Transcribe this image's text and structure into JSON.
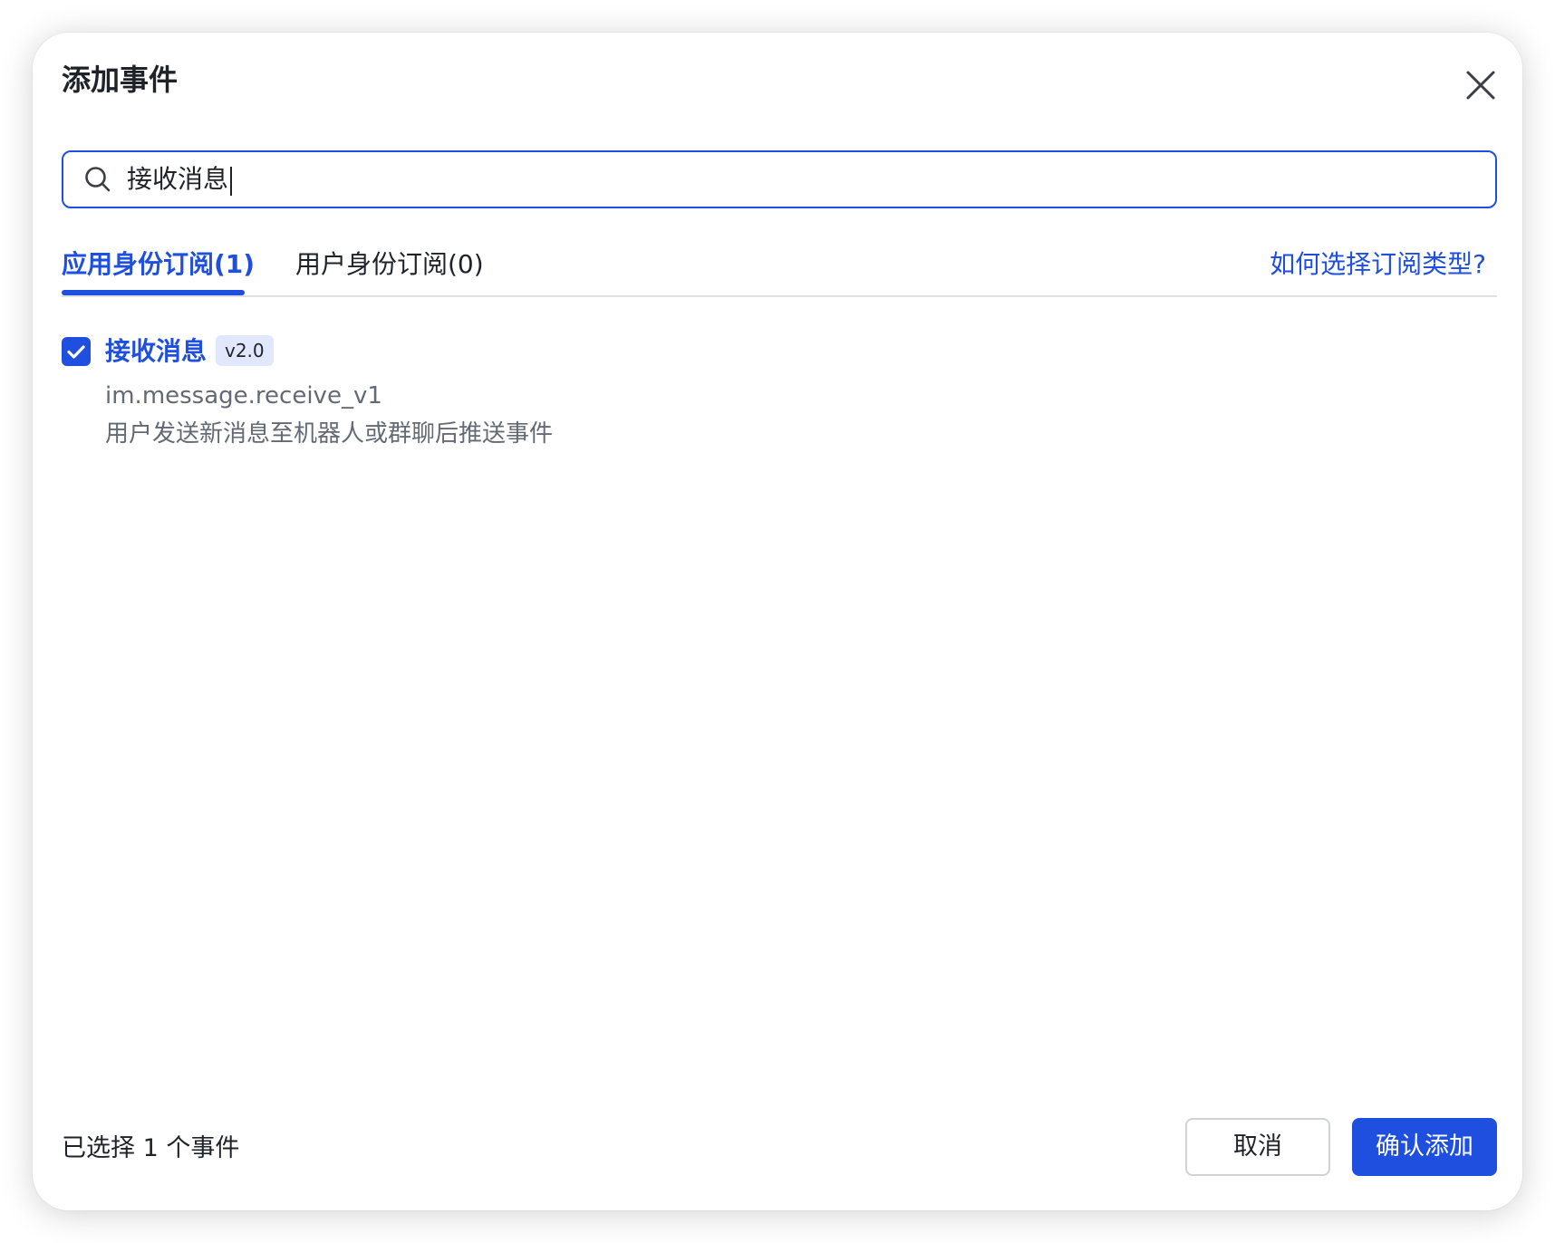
{
  "dialog": {
    "title": "添加事件",
    "close_icon": "close-icon"
  },
  "search": {
    "value": "接收消息",
    "icon": "search-icon"
  },
  "tabs": [
    {
      "label": "应用身份订阅(1)",
      "active": true
    },
    {
      "label": "用户身份订阅(0)",
      "active": false
    }
  ],
  "help_link": "如何选择订阅类型?",
  "events": [
    {
      "checked": true,
      "name": "接收消息",
      "version": "v2.0",
      "key": "im.message.receive_v1",
      "description": "用户发送新消息至机器人或群聊后推送事件"
    }
  ],
  "footer": {
    "selected_count": "已选择 1 个事件",
    "cancel_label": "取消",
    "confirm_label": "确认添加"
  },
  "colors": {
    "accent": "#1f4fdf",
    "badge_bg": "#e1e8fd",
    "text": "#1f2329",
    "secondary_text": "#646a73"
  }
}
